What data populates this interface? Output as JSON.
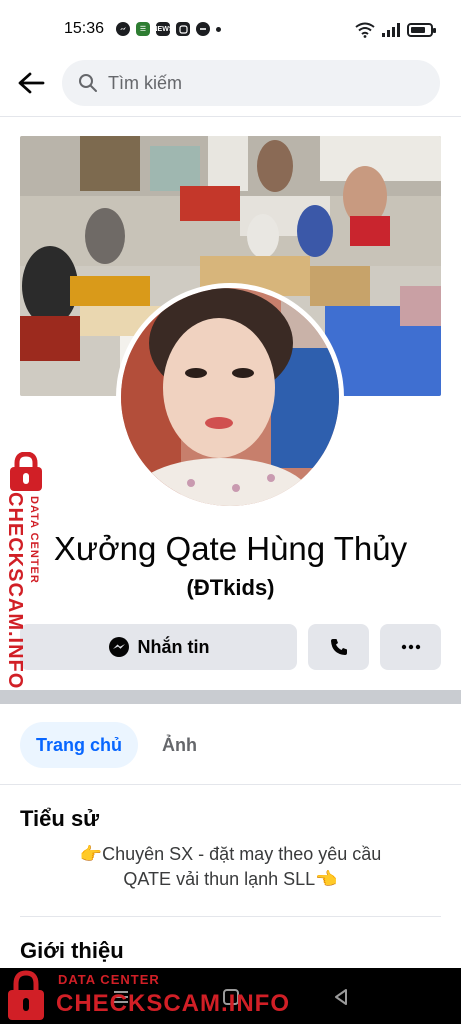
{
  "status_bar": {
    "time": "15:36",
    "battery_level": 0.75,
    "notification_icons": [
      "messenger-icon",
      "phone-app-icon",
      "news-app-icon",
      "gallery-icon",
      "music-icon",
      "more-dot-icon"
    ]
  },
  "search": {
    "placeholder": "Tìm kiếm"
  },
  "profile": {
    "name": "Xưởng Qate Hùng Thủy",
    "alternate_name": "(ĐTkids)"
  },
  "actions": {
    "message_label": "Nhắn tin",
    "call_icon": "phone-icon",
    "more_icon": "more-icon"
  },
  "tabs": [
    {
      "label": "Trang chủ",
      "active": true
    },
    {
      "label": "Ảnh",
      "active": false
    }
  ],
  "bio": {
    "heading": "Tiểu sử",
    "line1": "👉Chuyên SX - đặt may theo yêu cầu",
    "line2": "QATE vải thun lạnh SLL👈"
  },
  "intro": {
    "heading": "Giới thiệu"
  },
  "watermark": {
    "sub": "DATA CENTER",
    "main": "CHECKSCAM.INFO"
  },
  "colors": {
    "accent": "#0866ff",
    "watermark": "#d11f26",
    "button_bg": "#e4e6eb"
  }
}
